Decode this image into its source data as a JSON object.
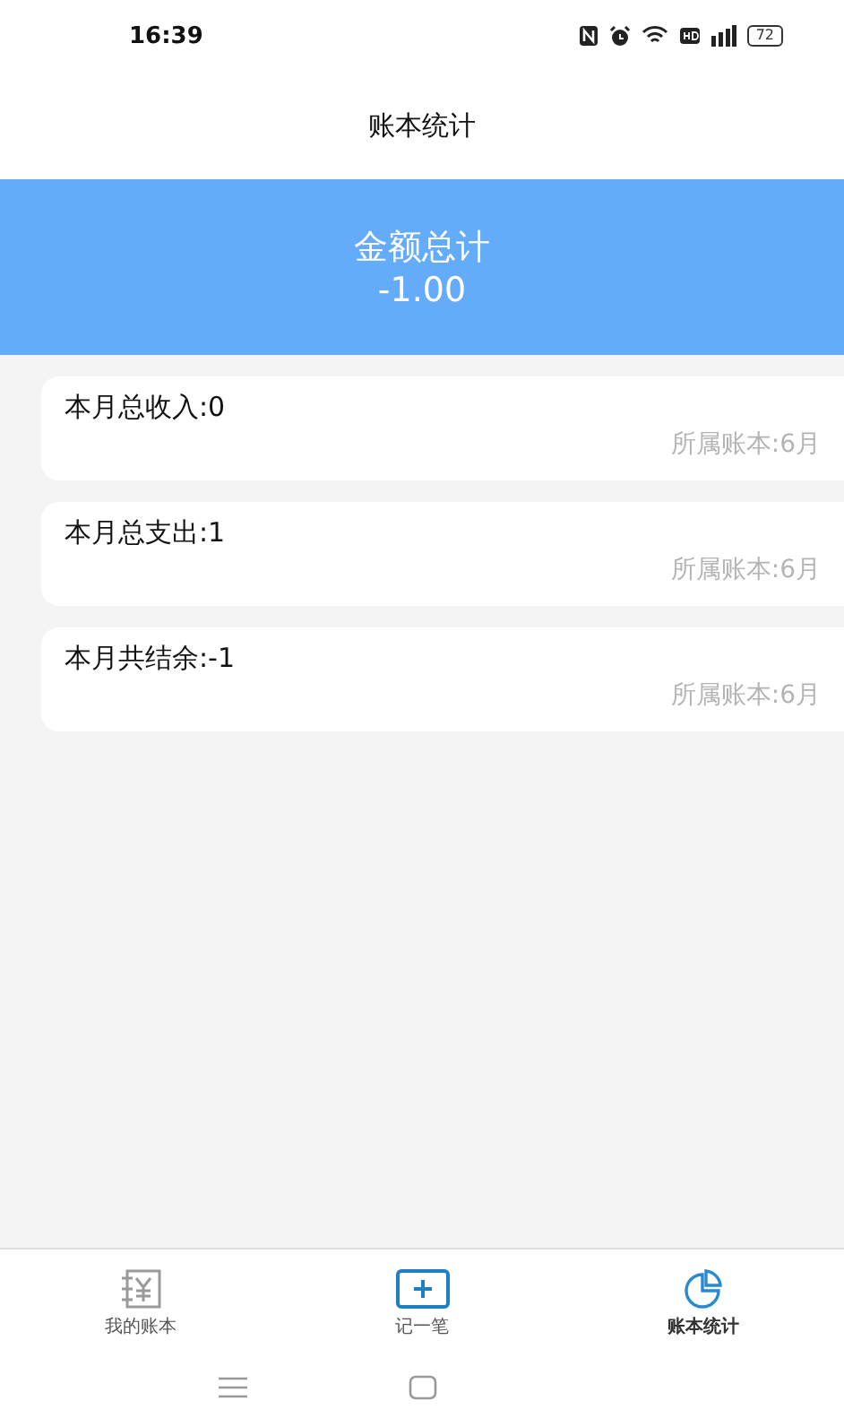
{
  "status_bar": {
    "time": "16:39",
    "battery": "72"
  },
  "header": {
    "title": "账本统计"
  },
  "summary": {
    "label": "金额总计",
    "amount": "-1.00"
  },
  "cards": [
    {
      "title": "本月总收入:0",
      "ledger": "所属账本:6月"
    },
    {
      "title": "本月总支出:1",
      "ledger": "所属账本:6月"
    },
    {
      "title": "本月共结余:-1",
      "ledger": "所属账本:6月"
    }
  ],
  "bottom_nav": [
    {
      "label": "我的账本",
      "kind": "book",
      "color": "#9a9a9a",
      "selected": false
    },
    {
      "label": "记一笔",
      "kind": "add",
      "color": "#1e7fc0",
      "selected": false
    },
    {
      "label": "账本统计",
      "kind": "chart",
      "color": "#2a8ad0",
      "selected": true
    }
  ]
}
